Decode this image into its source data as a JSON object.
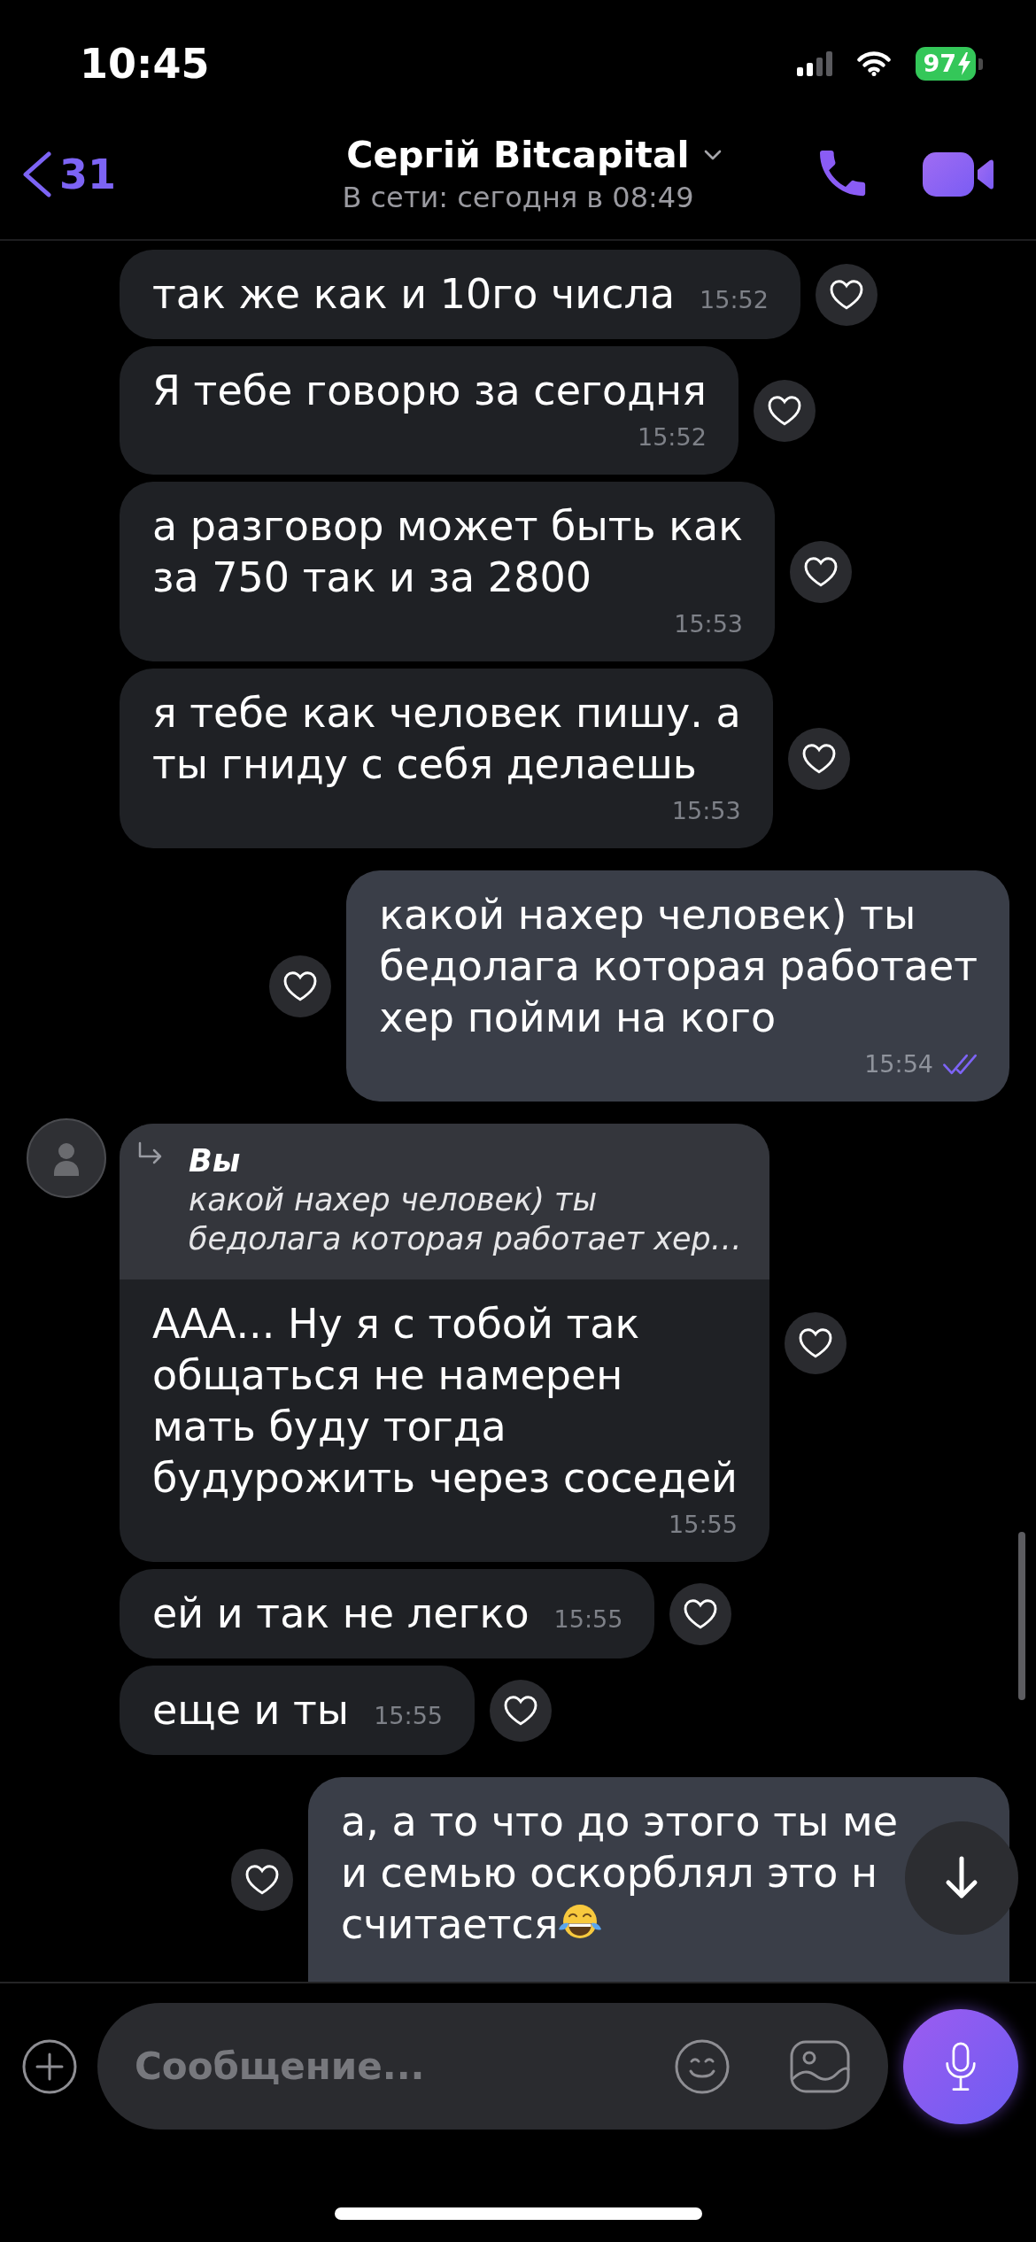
{
  "status_bar": {
    "time": "10:45",
    "battery": "97",
    "charging": true
  },
  "header": {
    "back_count": "31",
    "title": "Сергій Bitcapital",
    "subtitle": "В сети: сегодня в 08:49"
  },
  "messages": [
    {
      "kind": "incoming",
      "avatar": false,
      "text": "так же как и 10го числа",
      "time": "15:52",
      "time_inline": true
    },
    {
      "kind": "incoming",
      "avatar": false,
      "text": "Я тебе говорю за сегодня",
      "time": "15:52",
      "time_inline": false
    },
    {
      "kind": "incoming",
      "avatar": false,
      "text": "а разговор может быть как\nза 750 так и за 2800",
      "time": "15:53",
      "time_inline": false
    },
    {
      "kind": "incoming",
      "avatar": false,
      "text": "я тебе как человек пишу. а\nты гниду с себя делаешь",
      "time": "15:53",
      "time_inline": false
    },
    {
      "kind": "outgoing",
      "text": "какой нахер человек) ты\nбедолага которая работает\nхер пойми на кого",
      "time": "15:54",
      "time_inline": false,
      "read": true
    },
    {
      "kind": "incoming",
      "avatar": true,
      "reply_to": {
        "author": "Вы",
        "text": "какой нахер человек) ты\nбедолага которая работает хер…"
      },
      "text": "ААА... Ну я с тобой так\nобщаться не намерен\nмать буду тогда\nбудурожить через соседей",
      "time": "15:55",
      "time_inline": false
    },
    {
      "kind": "incoming",
      "avatar": false,
      "text": "ей и так не легко",
      "time": "15:55",
      "time_inline": true
    },
    {
      "kind": "incoming",
      "avatar": false,
      "text": "еще и ты",
      "time": "15:55",
      "time_inline": true
    },
    {
      "kind": "outgoing",
      "text": "а, а то что до этого ты ме\nи семью оскорблял это н\nсчитается",
      "inline_icon": {
        "kind": "tears-of-joy"
      }
    }
  ],
  "composer": {
    "placeholder": "Сообщение..."
  }
}
